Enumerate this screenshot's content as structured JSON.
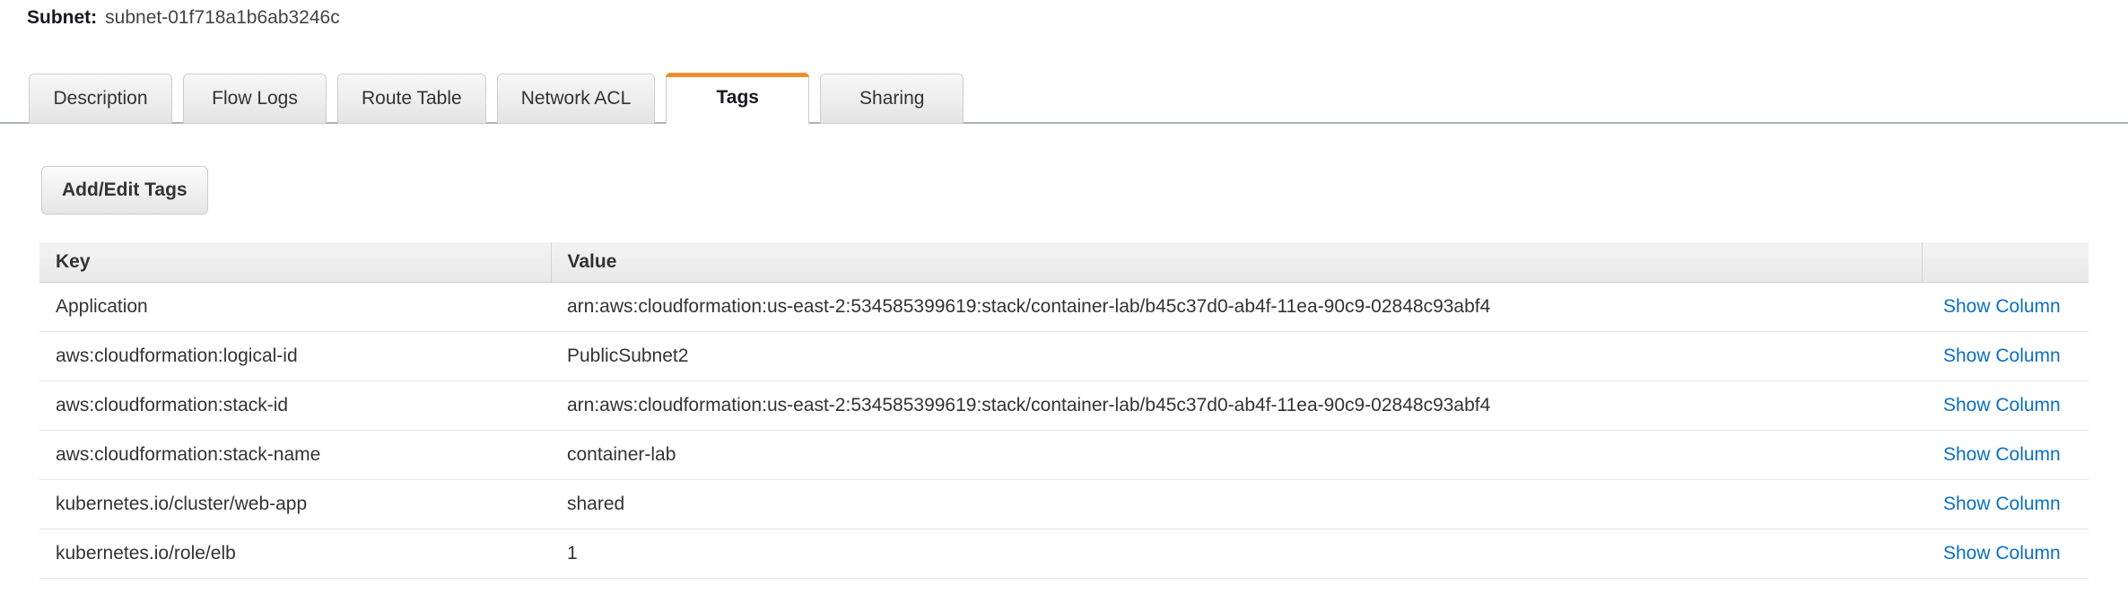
{
  "header": {
    "label": "Subnet:",
    "value": "subnet-01f718a1b6ab3246c"
  },
  "tabs": [
    {
      "label": "Description",
      "active": false
    },
    {
      "label": "Flow Logs",
      "active": false
    },
    {
      "label": "Route Table",
      "active": false
    },
    {
      "label": "Network ACL",
      "active": false
    },
    {
      "label": "Tags",
      "active": true
    },
    {
      "label": "Sharing",
      "active": false
    }
  ],
  "toolbar": {
    "add_edit_tags_label": "Add/Edit Tags"
  },
  "table": {
    "columns": [
      "Key",
      "Value",
      ""
    ],
    "rows": [
      {
        "key": "Application",
        "value": "arn:aws:cloudformation:us-east-2:534585399619:stack/container-lab/b45c37d0-ab4f-11ea-90c9-02848c93abf4",
        "action": "Show Column"
      },
      {
        "key": "aws:cloudformation:logical-id",
        "value": "PublicSubnet2",
        "action": "Show Column"
      },
      {
        "key": "aws:cloudformation:stack-id",
        "value": "arn:aws:cloudformation:us-east-2:534585399619:stack/container-lab/b45c37d0-ab4f-11ea-90c9-02848c93abf4",
        "action": "Show Column"
      },
      {
        "key": "aws:cloudformation:stack-name",
        "value": "container-lab",
        "action": "Show Column"
      },
      {
        "key": "kubernetes.io/cluster/web-app",
        "value": "shared",
        "action": "Show Column"
      },
      {
        "key": "kubernetes.io/role/elb",
        "value": "1",
        "action": "Show Column"
      }
    ]
  },
  "colors": {
    "active_tab_accent": "#ec912d",
    "link": "#0a6fc2",
    "header_row_bg": "#ececec",
    "tab_underline": "#aab2bd"
  }
}
